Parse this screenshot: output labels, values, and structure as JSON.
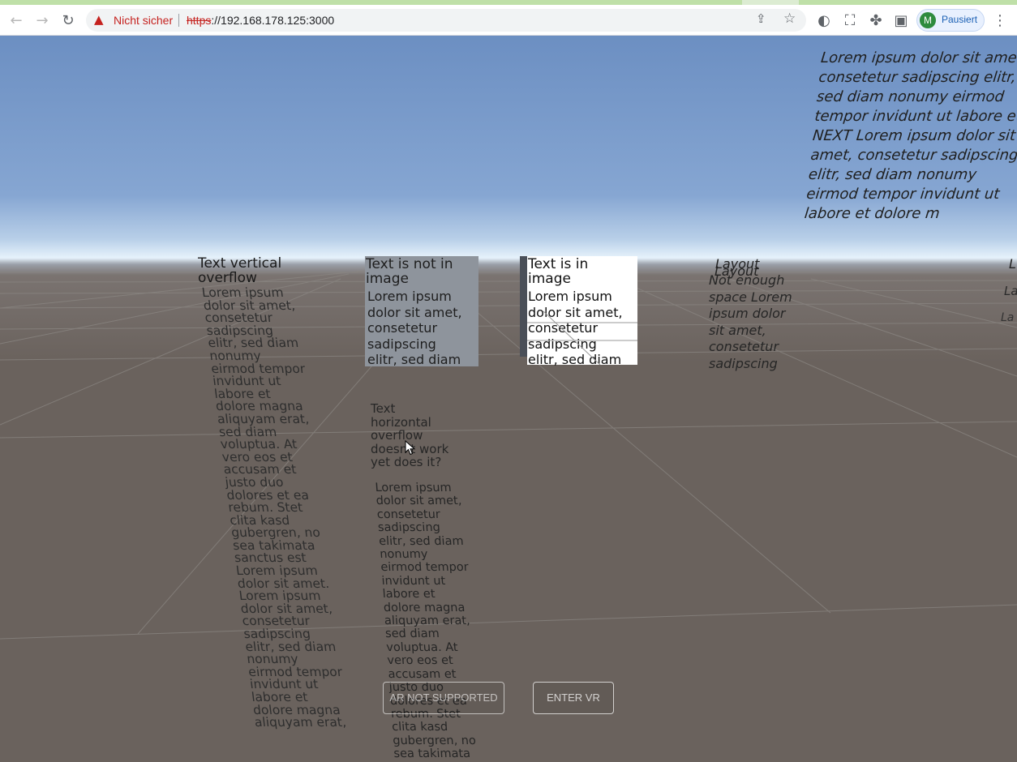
{
  "browser": {
    "nav_back": "←",
    "nav_forward": "→",
    "reload": "↻",
    "security_label": "Nicht sicher",
    "url_scheme": "https",
    "url_host": "://192.168.178.125:3000",
    "share": "⇪",
    "star": "☆",
    "extension_a": "◐",
    "extension_b": "⛶",
    "puzzle": "✤",
    "sidepanel": "▣",
    "profile_initial": "M",
    "profile_label": "Pausiert",
    "menu": "⋮"
  },
  "scene": {
    "sky_block": "Lorem ipsum dolor sit amet,\nconsetetur sadipscing elitr,\nsed diam nonumy eirmod\ntempor invidunt ut labore et\nNEXT Lorem ipsum dolor sit\namet, consetetur sadipscing\nelitr, sed diam nonumy\neirmod tempor invidunt ut\nlabore et dolore m",
    "panel1_title": "Text vertical\noverflow",
    "panel1_body": "Lorem ipsum\ndolor sit amet,\nconsetetur\nsadipscing\nelitr, sed diam\nnonumy\neirmod tempor\ninvidunt ut\nlabore et\ndolore magna\naliquyam erat,\nsed diam\nvoluptua. At\nvero eos et\naccusam et\njusto duo\ndolores et ea\nrebum. Stet\nclita kasd\ngubergren, no\nsea takimata\nsanctus est\nLorem ipsum\ndolor sit amet.\nLorem ipsum\ndolor sit amet,\nconsetetur\nsadipscing\nelitr, sed diam\nnonumy\neirmod tempor\ninvidunt ut\nlabore et\ndolore magna\naliquyam erat,",
    "panel2_title": "Text is not in\nimage",
    "panel2_body": "Lorem ipsum\ndolor sit amet,\nconsetetur\nsadipscing\nelitr, sed diam",
    "panel3_title": "Text is in\nimage",
    "panel3_body": "Lorem ipsum\ndolor sit amet,\nconsetetur\nsadipscing\nelitr, sed diam",
    "panel4_title": "Layout",
    "panel4_body": "Not enough\nspace Lorem\nipsum dolor\nsit amet,\nconsetetur\nsadipscing",
    "panel5_a": "L",
    "panel5_b": "La",
    "panel5_c": "La",
    "panel6_title": "Text\nhorizontal\noverflow\ndoesn't work\nyet does it?",
    "panel6_body": "Lorem ipsum\ndolor sit amet,\nconsetetur\nsadipscing\nelitr, sed diam\nnonumy\neirmod tempor\ninvidunt ut\nlabore et\ndolore magna\naliquyam erat,\nsed diam\nvoluptua. At\nvero eos et\naccusam et\njusto duo\ndolores et ea\nrebum. Stet\nclita kasd\ngubergren, no\nsea takimata\nsanctus est\nLorem ipsum"
  },
  "overlay": {
    "ar_button": "AR NOT SUPPORTED",
    "vr_button": "ENTER VR"
  },
  "colors": {
    "floor": "#6a625d",
    "sky_top": "#6c8fc2",
    "horizon": "#e6f2fb",
    "warning": "#c5221f",
    "profile_bg": "#e8f0fe"
  }
}
